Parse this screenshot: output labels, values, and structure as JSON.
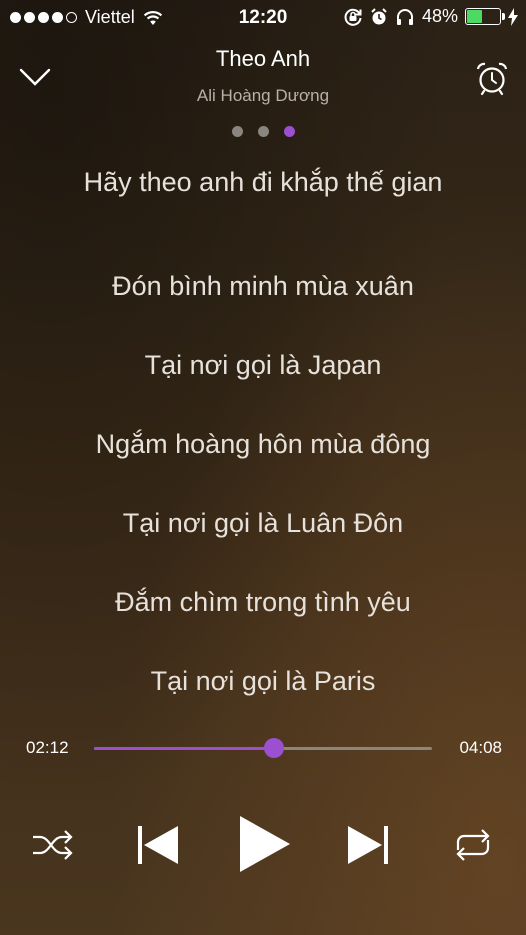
{
  "status_bar": {
    "carrier": "Viettel",
    "time": "12:20",
    "battery_percent": "48%",
    "battery_level": 0.48,
    "signal_dots_filled": 4,
    "signal_dots_total": 5
  },
  "header": {
    "title": "Theo Anh",
    "artist": "Ali Hoàng Dương",
    "page_count": 3,
    "active_page": 3
  },
  "lyrics": [
    "Hãy theo anh đi khắp thế gian",
    "Đón bình minh mùa xuân",
    "Tại nơi gọi là Japan",
    "Ngắm hoàng hôn mùa đông",
    "Tại nơi gọi là Luân Đôn",
    "Đắm chìm trong tình yêu",
    "Tại nơi gọi là Paris"
  ],
  "player": {
    "elapsed": "02:12",
    "total": "04:08",
    "progress": 0.532
  },
  "icons": {
    "down": "chevron-down-icon",
    "alarm": "alarm-clock-icon",
    "shuffle": "shuffle-icon",
    "previous": "previous-track-icon",
    "play": "play-icon",
    "next": "next-track-icon",
    "repeat": "repeat-icon"
  },
  "colors": {
    "accent": "#9b4fd1",
    "battery": "#4cd964"
  }
}
